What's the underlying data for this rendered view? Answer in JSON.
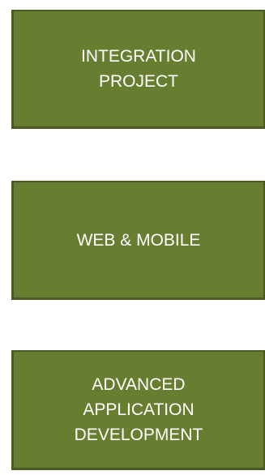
{
  "boxes": [
    {
      "label": "INTEGRATION PROJECT",
      "lines": [
        "INTEGRATION",
        "PROJECT"
      ]
    },
    {
      "label": "WEB & MOBILE",
      "lines": [
        "WEB & MOBILE"
      ]
    },
    {
      "label": "ADVANCED APPLICATION DEVELOPMENT",
      "lines": [
        "ADVANCED",
        "APPLICATION",
        "DEVELOPMENT"
      ]
    }
  ],
  "colors": {
    "box_fill": "#677d30",
    "box_border": "#4a5a22",
    "text": "#ffffff",
    "background": "#ffffff"
  }
}
